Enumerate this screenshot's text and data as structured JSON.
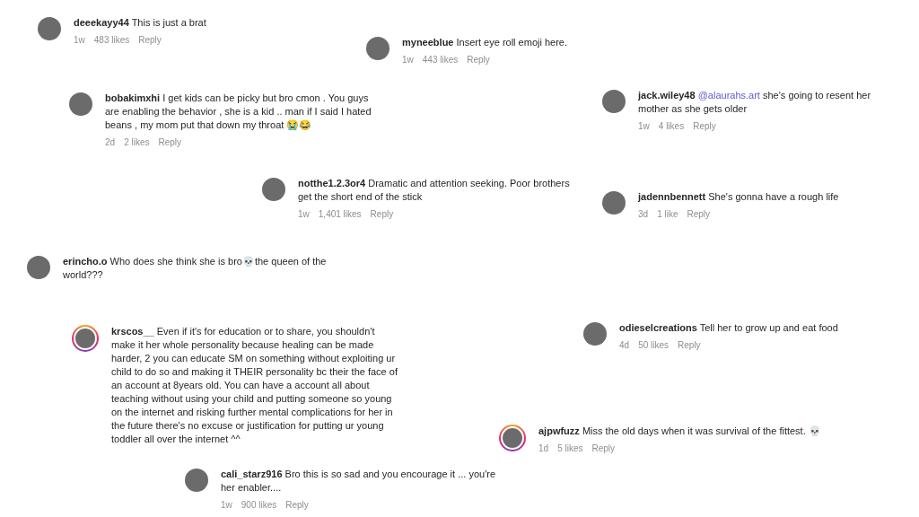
{
  "comments": [
    {
      "username": "deeekayy44",
      "text": "This is just a brat",
      "time": "1w",
      "likes": "483 likes",
      "reply": "Reply",
      "story_ring": false
    },
    {
      "username": "myneeblue",
      "text": "Insert eye roll emoji here.",
      "time": "1w",
      "likes": "443 likes",
      "reply": "Reply",
      "story_ring": false
    },
    {
      "username": "bobakimxhi",
      "text": "I get kids can be picky but bro cmon . You guys are enabling the behavior , she is a kid .. man if I said I hated beans , my mom put that down my throat 😭😂",
      "time": "2d",
      "likes": "2 likes",
      "reply": "Reply",
      "story_ring": false
    },
    {
      "username": "jack.wiley48",
      "mention": "@alaurahs.art",
      "text": "she's going to resent her mother as she gets older",
      "time": "1w",
      "likes": "4 likes",
      "reply": "Reply",
      "story_ring": false
    },
    {
      "username": "notthe1.2.3or4",
      "text": "Dramatic and attention seeking. Poor brothers get the short end of the stick",
      "time": "1w",
      "likes": "1,401 likes",
      "reply": "Reply",
      "story_ring": false
    },
    {
      "username": "jadennbennett",
      "text": "She's gonna have a rough life",
      "time": "3d",
      "likes": "1 like",
      "reply": "Reply",
      "story_ring": false
    },
    {
      "username": "erincho.o",
      "text": "Who does she think she is bro💀the queen of the world???",
      "story_ring": false
    },
    {
      "username": "krscos__",
      "text": "Even if it's for education or to share, you shouldn't make it her whole personality because healing can be made harder, 2 you can educate SM on something without exploiting ur child to do so and making it THEIR personality bc their the face of an account at 8years old. You can have a account all about teaching without using your child and putting someone so young on the internet and risking further mental complications for her in the future there's no excuse or justification for putting ur young toddler all over the internet ^^",
      "story_ring": true
    },
    {
      "username": "cali_starz916",
      "text": "Bro this is so sad and you encourage it ... you're her enabler....",
      "time": "1w",
      "likes": "900 likes",
      "reply": "Reply",
      "story_ring": false
    },
    {
      "username": "odieselcreations",
      "text": "Tell her to grow up and eat food",
      "time": "4d",
      "likes": "50 likes",
      "reply": "Reply",
      "story_ring": false
    },
    {
      "username": "ajpwfuzz",
      "text": "Miss the old days when it was survival of the fittest. 💀",
      "time": "1d",
      "likes": "5 likes",
      "reply": "Reply",
      "story_ring": true
    }
  ]
}
